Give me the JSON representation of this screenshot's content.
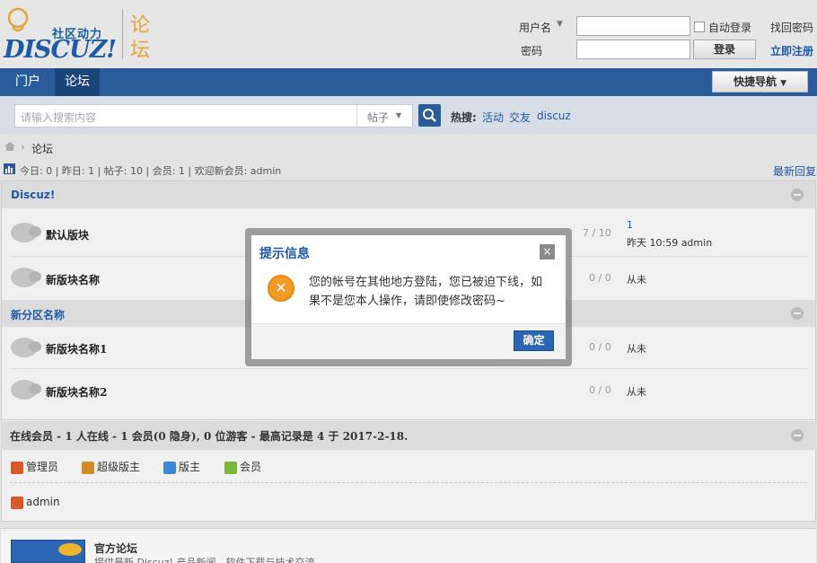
{
  "logo": {
    "subtitle": "社区动力",
    "wordmark": "DISCUZ!",
    "side_char_1": "论",
    "side_char_2": "坛"
  },
  "login": {
    "username_label": "用户名",
    "password_label": "密码",
    "auto_login": "自动登录",
    "forgot": "找回密码",
    "login_btn": "登录",
    "register": "立即注册"
  },
  "nav": {
    "items": [
      "门户",
      "论坛"
    ],
    "active": "论坛",
    "quick_nav": "快捷导航"
  },
  "search": {
    "placeholder": "请输入搜索内容",
    "type": "帖子",
    "hot_label": "热搜:",
    "hot_links": [
      "活动",
      "交友",
      "discuz"
    ]
  },
  "breadcrumb": [
    "论坛"
  ],
  "stats": "今日: 0 | 昨日: 1 | 帖子: 10 | 会员: 1 | 欢迎新会员: admin",
  "latest_reply": "最新回复",
  "categories": [
    {
      "title": "Discuz!",
      "forums": [
        {
          "name": "默认版块",
          "count": "7 / 10",
          "last_line1": "1",
          "last_line2": "昨天 10:59 admin"
        },
        {
          "name": "新版块名称",
          "count": "0 / 0",
          "last_line1": "",
          "last_line2": "从未"
        }
      ]
    },
    {
      "title": "新分区名称",
      "forums": [
        {
          "name": "新版块名称1",
          "count": "0 / 0",
          "last_line1": "",
          "last_line2": "从未"
        },
        {
          "name": "新版块名称2",
          "count": "0 / 0",
          "last_line1": "",
          "last_line2": "从未"
        }
      ]
    }
  ],
  "online": {
    "summary": "在线会员 - 1 人在线 - 1 会员(0 隐身), 0 位游客 - 最高记录是 4 于 2017-2-18.",
    "roles": [
      {
        "label": "管理员",
        "color": "#d9582a"
      },
      {
        "label": "超级版主",
        "color": "#d28c27"
      },
      {
        "label": "版主",
        "color": "#3b8ad0"
      },
      {
        "label": "会员",
        "color": "#7ab73c"
      }
    ],
    "user": "admin"
  },
  "footer": {
    "title": "官方论坛",
    "desc": "提供最新 Discuz! 产品新闻、软件下载与技术交流"
  },
  "modal": {
    "title": "提示信息",
    "close": "×",
    "message": "您的帐号在其他地方登陆，您已被迫下线，如果不是您本人操作，请即使修改密码~",
    "ok": "确定"
  }
}
